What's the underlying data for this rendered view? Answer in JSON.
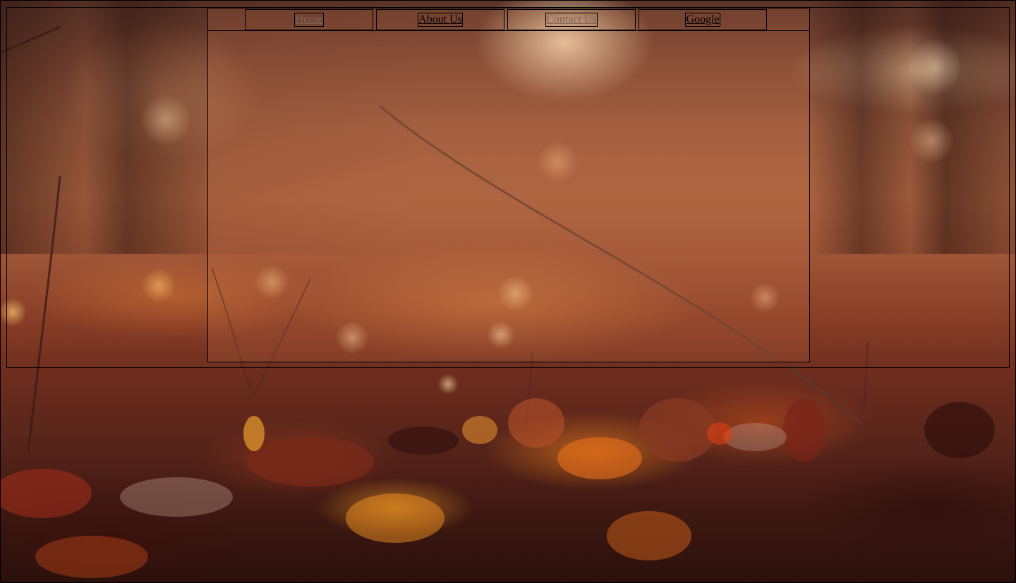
{
  "nav": {
    "items": [
      {
        "label": "Home",
        "active": false,
        "muted": true
      },
      {
        "label": "About Us",
        "active": false,
        "muted": false
      },
      {
        "label": "Contact Us",
        "active": false,
        "muted": true
      },
      {
        "label": "Google",
        "active": false,
        "muted": false
      }
    ]
  },
  "colors": {
    "link": "#000000",
    "link_muted": "#7a6258",
    "border": "#000000"
  }
}
